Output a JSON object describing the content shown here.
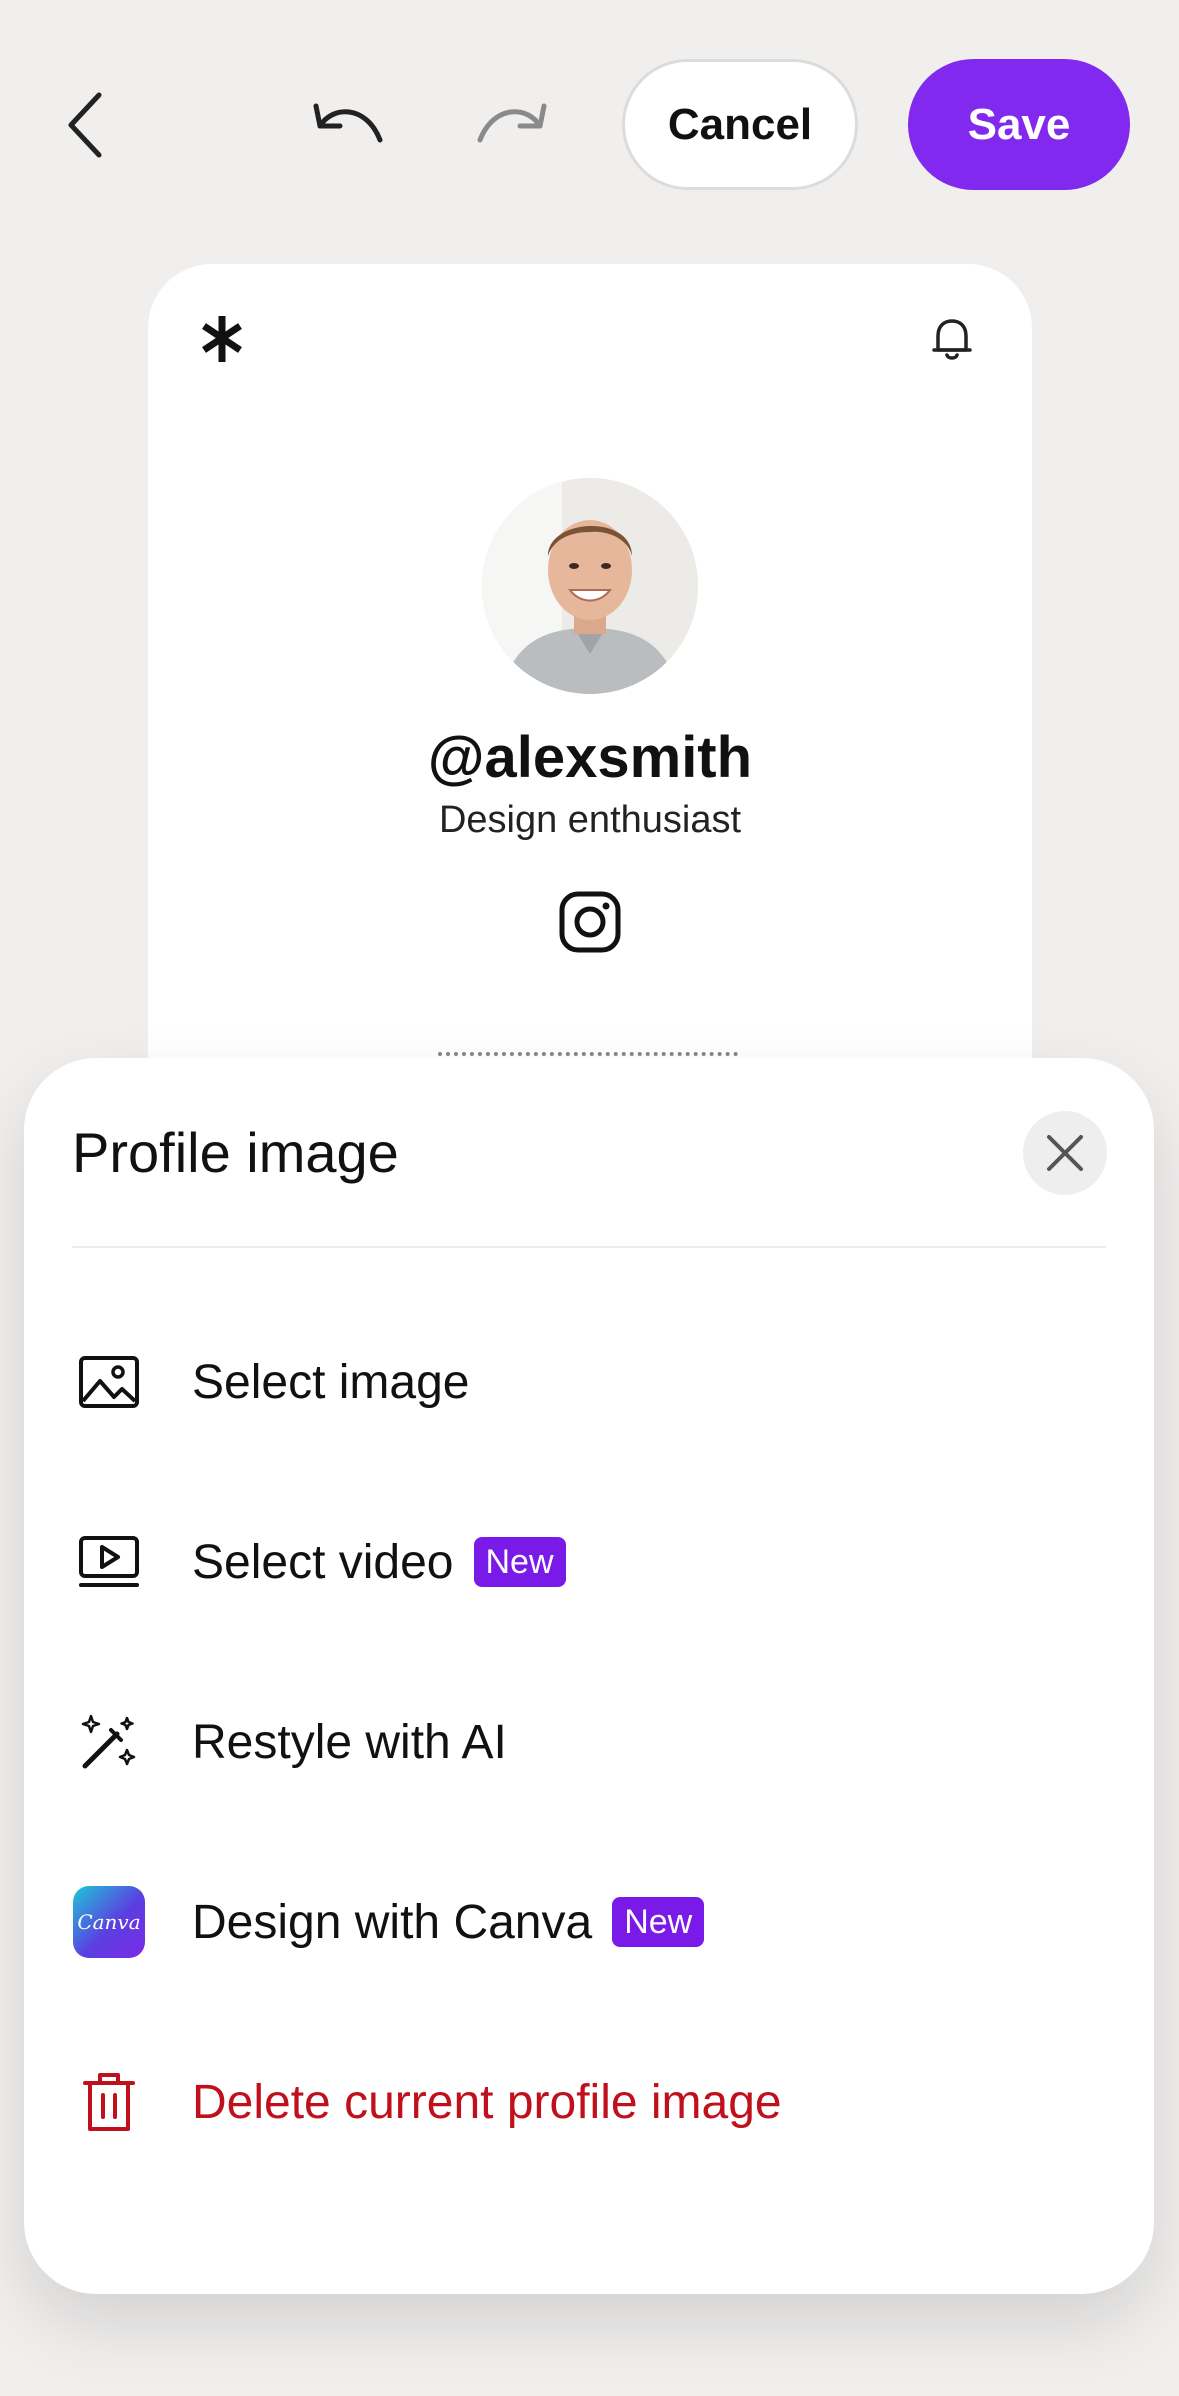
{
  "toolbar": {
    "back_icon": "chevron-left-icon",
    "undo_icon": "undo-icon",
    "redo_icon": "redo-icon",
    "cancel_label": "Cancel",
    "save_label": "Save",
    "save_color": "#8129ef"
  },
  "preview": {
    "username": "@alexsmith",
    "bio": "Design enthusiast",
    "social_icon": "instagram-icon"
  },
  "sheet": {
    "title": "Profile image",
    "options": [
      {
        "label": "Select image",
        "icon": "image-icon"
      },
      {
        "label": "Select video",
        "icon": "video-icon",
        "badge": "New"
      },
      {
        "label": "Restyle with AI",
        "icon": "magic-wand-icon"
      },
      {
        "label": "Design with Canva",
        "icon": "canva-logo",
        "badge": "New",
        "logo_text": "Canva"
      },
      {
        "label": "Delete current profile image",
        "icon": "trash-icon",
        "danger": true
      }
    ],
    "badge_color": "#7a1ae8",
    "danger_color": "#c0101b"
  }
}
